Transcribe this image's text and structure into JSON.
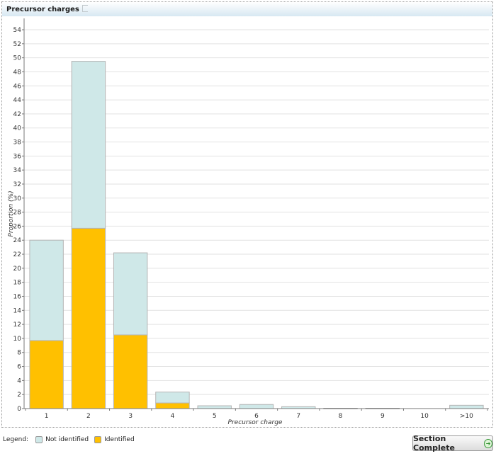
{
  "panel": {
    "title": "Precursor charges",
    "flag_icon": "flag-icon"
  },
  "chart_data": {
    "type": "bar",
    "stacked": true,
    "title": "Precursor charges",
    "xlabel": "Precursor charge",
    "ylabel": "Proportion (%)",
    "categories": [
      "1",
      "2",
      "3",
      "4",
      "5",
      "6",
      "7",
      "8",
      "9",
      "10",
      ">10"
    ],
    "series": [
      {
        "name": "Identified",
        "color": "#ffc000",
        "values": [
          9.7,
          25.7,
          10.5,
          0.8,
          0,
          0,
          0,
          0,
          0,
          0,
          0
        ]
      },
      {
        "name": "Not identified",
        "color": "#cfe8e8",
        "values": [
          14.3,
          23.8,
          11.7,
          1.55,
          0.4,
          0.58,
          0.27,
          0.05,
          0.05,
          0,
          0.47
        ]
      }
    ],
    "ylim": [
      0,
      55
    ],
    "yticks": [
      0,
      2,
      4,
      6,
      8,
      10,
      12,
      14,
      16,
      18,
      20,
      22,
      24,
      26,
      28,
      30,
      32,
      34,
      36,
      38,
      40,
      42,
      44,
      46,
      48,
      50,
      52,
      54
    ],
    "grid": true,
    "legend": "bottom-left"
  },
  "legend": {
    "label": "Legend:",
    "items": [
      {
        "label": "Not identified",
        "color": "#cfe8e8"
      },
      {
        "label": "Identified",
        "color": "#ffc000"
      }
    ]
  },
  "footer": {
    "section_complete_label": "Section Complete",
    "go_icon": "➔"
  }
}
